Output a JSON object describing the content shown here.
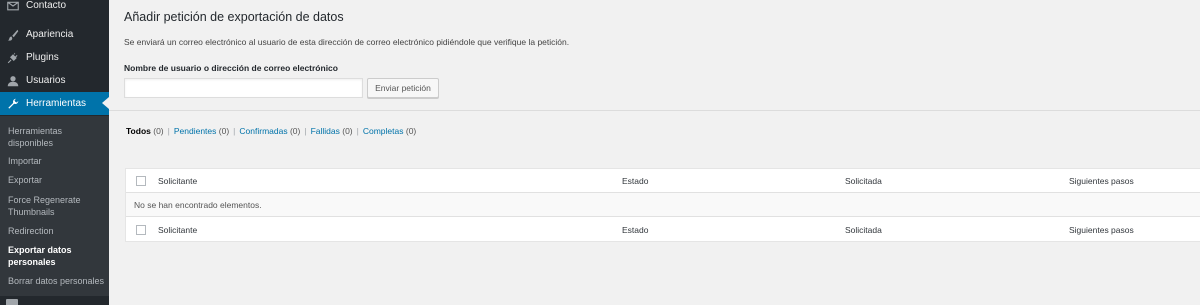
{
  "sidebar": {
    "items": [
      {
        "label": "Contacto",
        "icon": "mail-icon"
      },
      {
        "label": "Apariencia",
        "icon": "paintbrush-icon"
      },
      {
        "label": "Plugins",
        "icon": "plug-icon"
      },
      {
        "label": "Usuarios",
        "icon": "user-icon"
      },
      {
        "label": "Herramientas",
        "icon": "wrench-icon"
      }
    ],
    "submenu": [
      {
        "label": "Herramientas disponibles"
      },
      {
        "label": "Importar"
      },
      {
        "label": "Exportar"
      },
      {
        "label": "Force Regenerate Thumbnails"
      },
      {
        "label": "Redirection"
      },
      {
        "label": "Exportar datos personales"
      },
      {
        "label": "Borrar datos personales"
      }
    ],
    "active_color": "#0073aa"
  },
  "form": {
    "title": "Añadir petición de exportación de datos",
    "description": "Se enviará un correo electrónico al usuario de esta dirección de correo electrónico pidiéndole que verifique la petición.",
    "field_label": "Nombre de usuario o dirección de correo electrónico",
    "field_value": "",
    "button_label": "Enviar petición"
  },
  "views": [
    {
      "label": "Todos",
      "count": "(0)"
    },
    {
      "label": "Pendientes",
      "count": "(0)"
    },
    {
      "label": "Confirmadas",
      "count": "(0)"
    },
    {
      "label": "Fallidas",
      "count": "(0)"
    },
    {
      "label": "Completas",
      "count": "(0)"
    }
  ],
  "table": {
    "columns": [
      "Solicitante",
      "Estado",
      "Solicitada",
      "Siguientes pasos"
    ],
    "empty_message": "No se han encontrado elementos."
  }
}
